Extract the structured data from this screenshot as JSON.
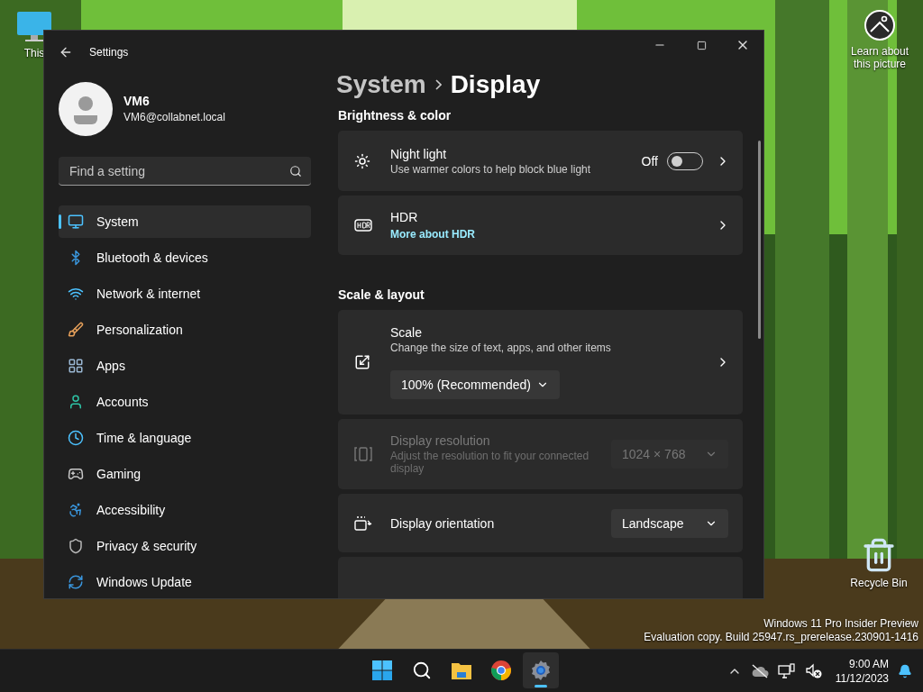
{
  "desktop_icons": [
    {
      "label": "This"
    },
    {
      "label": "Recycle Bin"
    }
  ],
  "spotlight": {
    "label": "Learn about this picture"
  },
  "window": {
    "title": "Settings",
    "user": {
      "name": "VM6",
      "email": "VM6@collabnet.local"
    },
    "search": {
      "placeholder": "Find a setting"
    },
    "nav": [
      {
        "label": "System",
        "selected": true
      },
      {
        "label": "Bluetooth & devices",
        "selected": false
      },
      {
        "label": "Network & internet",
        "selected": false
      },
      {
        "label": "Personalization",
        "selected": false
      },
      {
        "label": "Apps",
        "selected": false
      },
      {
        "label": "Accounts",
        "selected": false
      },
      {
        "label": "Time & language",
        "selected": false
      },
      {
        "label": "Gaming",
        "selected": false
      },
      {
        "label": "Accessibility",
        "selected": false
      },
      {
        "label": "Privacy & security",
        "selected": false
      },
      {
        "label": "Windows Update",
        "selected": false
      }
    ],
    "breadcrumb": [
      "System",
      "Display"
    ],
    "sections": [
      {
        "title": "Brightness & color",
        "cards": [
          {
            "kind": "toggle",
            "title": "Night light",
            "description": "Use warmer colors to help block blue light",
            "state_text": "Off",
            "on": false,
            "chevron": true,
            "disabled": false
          },
          {
            "kind": "link",
            "title": "HDR",
            "link": "More about HDR",
            "chevron": true,
            "disabled": false
          }
        ]
      },
      {
        "title": "Scale & layout",
        "cards": [
          {
            "kind": "dropdown-below",
            "title": "Scale",
            "description": "Change the size of text, apps, and other items",
            "value": "100% (Recommended)",
            "chevron": true,
            "disabled": false
          },
          {
            "kind": "dropdown",
            "title": "Display resolution",
            "description": "Adjust the resolution to fit your connected display",
            "value": "1024 × 768",
            "chevron": false,
            "disabled": true
          },
          {
            "kind": "dropdown",
            "title": "Display orientation",
            "value": "Landscape",
            "chevron": false,
            "disabled": false
          },
          {
            "kind": "blank"
          }
        ]
      }
    ]
  },
  "watermark": [
    "Windows 11 Pro Insider Preview",
    "Evaluation copy. Build 25947.rs_prerelease.230901-1416"
  ],
  "taskbar": {
    "apps": [
      {
        "selected": false
      },
      {
        "selected": false
      },
      {
        "selected": false
      },
      {
        "selected": false
      },
      {
        "selected": true
      }
    ],
    "time": "9:00 AM",
    "date": "11/12/2023"
  }
}
